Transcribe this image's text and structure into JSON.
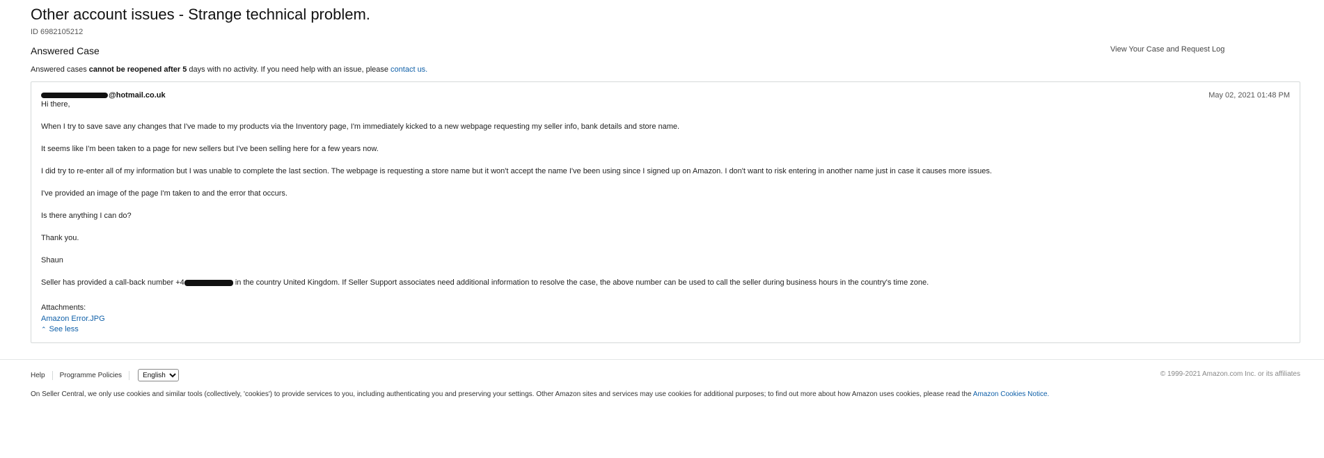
{
  "case": {
    "title": "Other account issues - Strange technical problem.",
    "id_label": "ID 6982105212",
    "status": "Answered Case",
    "log_link": "View Your Case and Request Log"
  },
  "notice": {
    "prefix": "Answered cases ",
    "bold": "cannot be reopened after 5",
    "middle": " days with no activity. If you need help with an issue, please ",
    "link": "contact us."
  },
  "message": {
    "sender_domain": "@hotmail.co.uk",
    "date": "May 02, 2021 01:48 PM",
    "lines": [
      "Hi there,",
      "When I try to save save any changes that I've made to my products via the Inventory page, I'm immediately kicked to a new webpage requesting my seller info, bank details and store name.",
      "It seems like I'm been taken to a page for new sellers but I've been selling here for a few years now.",
      "I did try to re-enter all of my information but I was unable to complete the last section. The webpage is requesting a store name but it won't accept the name I've been using since I signed up on Amazon. I don't want to risk entering in another name just in case it causes more issues.",
      "I've provided an image of the page I'm taken to and the error that occurs.",
      "Is there anything I can do?",
      "Thank you.",
      "Shaun"
    ],
    "callback_prefix": "Seller has provided a call-back number +4",
    "callback_suffix": " in the country United Kingdom. If Seller Support associates need additional information to resolve the case, the above number can be used to call the seller during business hours in the country's time zone.",
    "attachments_label": "Attachments:",
    "attachment_name": "Amazon Error.JPG",
    "see_less": "See less",
    "see_less_icon": "chevron-up-icon"
  },
  "footer": {
    "help": "Help",
    "policies": "Programme Policies",
    "language_selected": "English",
    "copyright": "© 1999-2021 Amazon.com Inc. or its affiliates",
    "cookie_text": "On Seller Central, we only use cookies and similar tools (collectively, 'cookies') to provide services to you, including authenticating you and preserving your settings. Other Amazon sites and services may use cookies for additional purposes; to find out more about how Amazon uses cookies, please read the ",
    "cookie_link": "Amazon Cookies Notice."
  },
  "colors": {
    "link": "#0e5fa8",
    "border": "#d5d9d9",
    "redaction": "#111111"
  }
}
